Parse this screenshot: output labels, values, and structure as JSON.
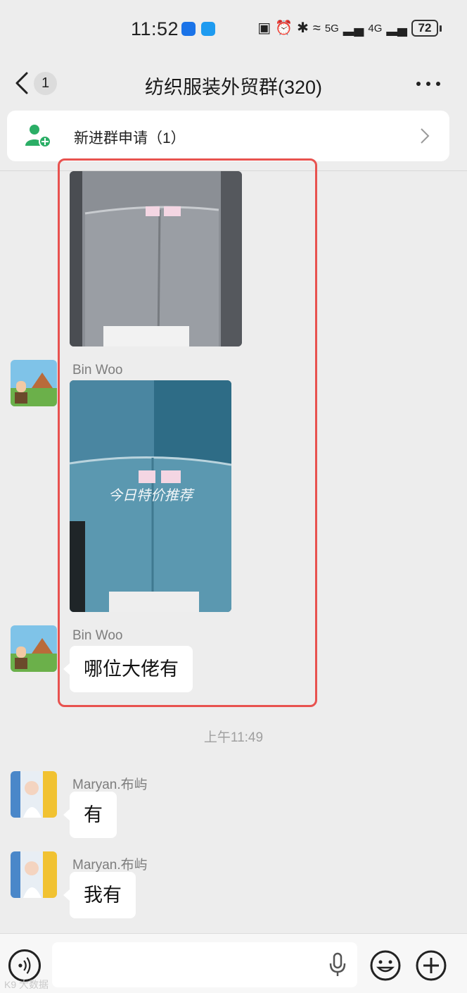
{
  "status_bar": {
    "time": "11:52",
    "network_labels": [
      "5G",
      "4G"
    ],
    "battery": "72"
  },
  "nav": {
    "unread_count": "1",
    "title": "纺织服装外贸群(320)"
  },
  "join_request": {
    "label": "新进群申请（1）"
  },
  "messages": [
    {
      "sender": "Bin Woo",
      "type": "image"
    },
    {
      "sender": "Bin Woo",
      "type": "image",
      "overlay_text": "今日特价推荐"
    },
    {
      "sender": "Bin Woo",
      "type": "text",
      "text": "哪位大佬有"
    },
    {
      "sender": "Maryan.布屿",
      "type": "text",
      "text": "有"
    },
    {
      "sender": "Maryan.布屿",
      "type": "text",
      "text": "我有"
    }
  ],
  "time_separator": "上午11:49",
  "watermark": "K9 大数据",
  "colors": {
    "background": "#ededed",
    "highlight_border": "#e8524f",
    "join_icon": "#2bae66",
    "bubble": "#ffffff"
  },
  "icons": [
    "back-arrow-icon",
    "more-icon",
    "add-user-icon",
    "chevron-right-icon",
    "voice-icon",
    "mic-icon",
    "emoji-icon",
    "plus-icon"
  ]
}
